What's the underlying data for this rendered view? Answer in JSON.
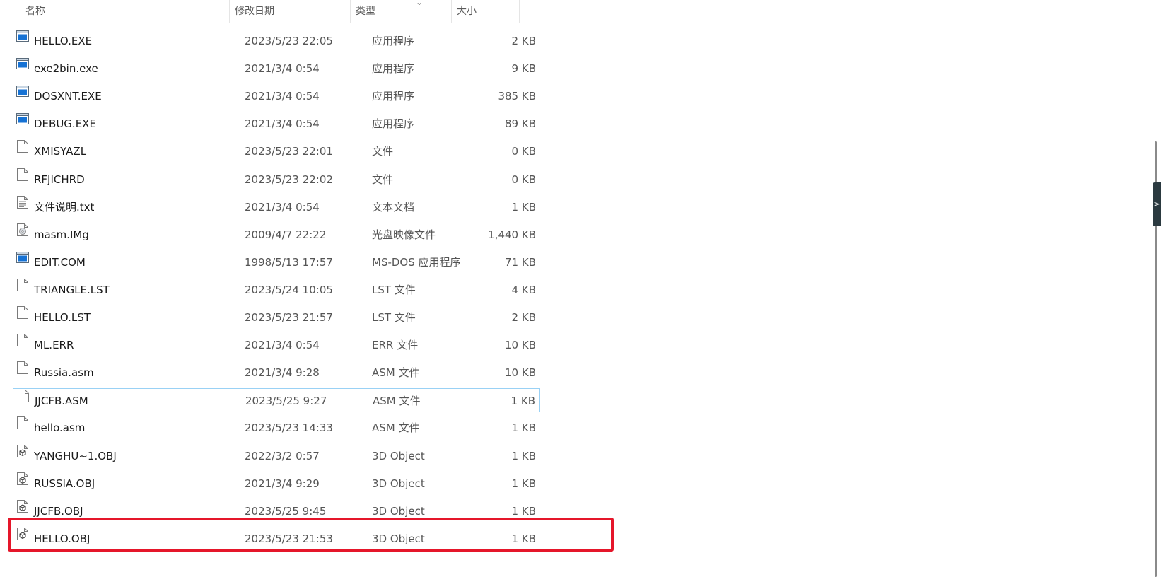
{
  "columns": {
    "name": "名称",
    "date": "修改日期",
    "type": "类型",
    "size": "大小"
  },
  "sort_indicator": "chevron-down-icon",
  "side_tab_label": ">",
  "files": [
    {
      "name": "HELLO.EXE",
      "date": "2023/5/23 22:05",
      "type": "应用程序",
      "size": "2 KB",
      "icon": "app-icon"
    },
    {
      "name": "exe2bin.exe",
      "date": "2021/3/4 0:54",
      "type": "应用程序",
      "size": "9 KB",
      "icon": "app-icon"
    },
    {
      "name": "DOSXNT.EXE",
      "date": "2021/3/4 0:54",
      "type": "应用程序",
      "size": "385 KB",
      "icon": "app-icon"
    },
    {
      "name": "DEBUG.EXE",
      "date": "2021/3/4 0:54",
      "type": "应用程序",
      "size": "89 KB",
      "icon": "app-icon"
    },
    {
      "name": "XMISYAZL",
      "date": "2023/5/23 22:01",
      "type": "文件",
      "size": "0 KB",
      "icon": "file-icon"
    },
    {
      "name": "RFJICHRD",
      "date": "2023/5/23 22:02",
      "type": "文件",
      "size": "0 KB",
      "icon": "file-icon"
    },
    {
      "name": "文件说明.txt",
      "date": "2021/3/4 0:54",
      "type": "文本文档",
      "size": "1 KB",
      "icon": "text-file-icon"
    },
    {
      "name": "masm.IMg",
      "date": "2009/4/7 22:22",
      "type": "光盘映像文件",
      "size": "1,440 KB",
      "icon": "disc-image-icon"
    },
    {
      "name": "EDIT.COM",
      "date": "1998/5/13 17:57",
      "type": "MS-DOS 应用程序",
      "size": "71 KB",
      "icon": "app-icon"
    },
    {
      "name": "TRIANGLE.LST",
      "date": "2023/5/24 10:05",
      "type": "LST 文件",
      "size": "4 KB",
      "icon": "file-icon"
    },
    {
      "name": "HELLO.LST",
      "date": "2023/5/23 21:57",
      "type": "LST 文件",
      "size": "2 KB",
      "icon": "file-icon"
    },
    {
      "name": "ML.ERR",
      "date": "2021/3/4 0:54",
      "type": "ERR 文件",
      "size": "10 KB",
      "icon": "file-icon"
    },
    {
      "name": "Russia.asm",
      "date": "2021/3/4 9:28",
      "type": "ASM 文件",
      "size": "10 KB",
      "icon": "file-icon"
    },
    {
      "name": "JJCFB.ASM",
      "date": "2023/5/25 9:27",
      "type": "ASM 文件",
      "size": "1 KB",
      "icon": "file-icon",
      "focused": true
    },
    {
      "name": "hello.asm",
      "date": "2023/5/23 14:33",
      "type": "ASM 文件",
      "size": "1 KB",
      "icon": "file-icon"
    },
    {
      "name": "YANGHU~1.OBJ",
      "date": "2022/3/2 0:57",
      "type": "3D Object",
      "size": "1 KB",
      "icon": "3d-object-icon"
    },
    {
      "name": "RUSSIA.OBJ",
      "date": "2021/3/4 9:29",
      "type": "3D Object",
      "size": "1 KB",
      "icon": "3d-object-icon"
    },
    {
      "name": "JJCFB.OBJ",
      "date": "2023/5/25 9:45",
      "type": "3D Object",
      "size": "1 KB",
      "icon": "3d-object-icon",
      "highlighted": true
    },
    {
      "name": "HELLO.OBJ",
      "date": "2023/5/23 21:53",
      "type": "3D Object",
      "size": "1 KB",
      "icon": "3d-object-icon"
    }
  ],
  "colors": {
    "highlight_border": "#e5162a",
    "focus_border": "#99d1f5",
    "app_icon_blue": "#1672d4"
  }
}
